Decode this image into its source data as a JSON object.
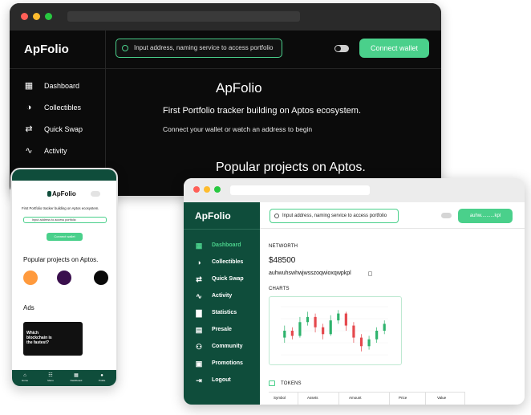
{
  "dark_window": {
    "logo": "ApFolio",
    "search_placeholder": "Input address, naming service to access portfolio",
    "connect_label": "Connect wallet",
    "nav": [
      {
        "label": "Dashboard",
        "icon": "grid-icon"
      },
      {
        "label": "Collectibles",
        "icon": "palette-icon"
      },
      {
        "label": "Quick Swap",
        "icon": "swap-icon"
      },
      {
        "label": "Activity",
        "icon": "activity-icon"
      }
    ],
    "hero_title": "ApFolio",
    "hero_subtitle": "First Portfolio tracker building on Aptos ecosystem.",
    "hero_desc": "Connect your wallet or watch an address to begin",
    "popular_title": "Popular projects on Aptos."
  },
  "phone": {
    "logo": "ApFolio",
    "tagline": "First Portfolio tracker building on Aptos ecosystem.",
    "search_placeholder": "Input address to access portfolio",
    "connect_label": "Connect wallet",
    "popular_title": "Popular projects on Aptos.",
    "ads_title": "Ads",
    "banner_lines": [
      "Which",
      "blockchain is",
      "the fastest?"
    ],
    "tabs": [
      {
        "label": "Home",
        "icon": "home-icon"
      },
      {
        "label": "Menu",
        "icon": "menu-icon"
      },
      {
        "label": "Dashboard",
        "icon": "dashboard-icon"
      },
      {
        "label": "Profile",
        "icon": "profile-icon"
      }
    ]
  },
  "light_window": {
    "logo": "ApFolio",
    "search_placeholder": "Input address, naming service to access portfolio",
    "address_button": "auhw..........kpl",
    "nav": [
      {
        "label": "Dashboard",
        "icon": "grid-icon",
        "active": true
      },
      {
        "label": "Collectibles",
        "icon": "palette-icon",
        "active": false
      },
      {
        "label": "Quick Swap",
        "icon": "swap-icon",
        "active": false
      },
      {
        "label": "Activity",
        "icon": "activity-icon",
        "active": false
      },
      {
        "label": "Statistics",
        "icon": "stats-icon",
        "active": false
      },
      {
        "label": "Presale",
        "icon": "presale-icon",
        "active": false
      },
      {
        "label": "Community",
        "icon": "community-icon",
        "active": false
      },
      {
        "label": "Promotions",
        "icon": "promotions-icon",
        "active": false
      },
      {
        "label": "Logout",
        "icon": "logout-icon",
        "active": false
      }
    ],
    "networth_label": "NETWORTH",
    "networth_value": "$48500",
    "wallet_address": "auhwuhswhwjwsszoqwioxqwpkpl",
    "charts_label": "CHARTS",
    "tokens_label": "TOKENS",
    "table_headers": [
      "Symbol",
      "Assets",
      "Amount",
      "Price",
      "Value"
    ]
  },
  "colors": {
    "accent": "#4ad08b",
    "sidebar": "#0f4d3b",
    "dark_bg": "#0b0b0b",
    "candle_up": "#2fb36d",
    "candle_down": "#e5484d"
  },
  "chart_data": {
    "type": "candlestick",
    "candles": [
      {
        "o": 48,
        "c": 52,
        "h": 55,
        "l": 45
      },
      {
        "o": 52,
        "c": 49,
        "h": 54,
        "l": 47
      },
      {
        "o": 49,
        "c": 57,
        "h": 60,
        "l": 48
      },
      {
        "o": 57,
        "c": 60,
        "h": 63,
        "l": 55
      },
      {
        "o": 60,
        "c": 54,
        "h": 62,
        "l": 51
      },
      {
        "o": 54,
        "c": 50,
        "h": 56,
        "l": 47
      },
      {
        "o": 50,
        "c": 58,
        "h": 61,
        "l": 49
      },
      {
        "o": 58,
        "c": 62,
        "h": 64,
        "l": 56
      },
      {
        "o": 62,
        "c": 55,
        "h": 63,
        "l": 52
      },
      {
        "o": 55,
        "c": 48,
        "h": 57,
        "l": 45
      },
      {
        "o": 48,
        "c": 43,
        "h": 50,
        "l": 40
      },
      {
        "o": 43,
        "c": 47,
        "h": 49,
        "l": 41
      },
      {
        "o": 47,
        "c": 52,
        "h": 54,
        "l": 45
      },
      {
        "o": 52,
        "c": 56,
        "h": 58,
        "l": 50
      }
    ],
    "ylim": [
      38,
      66
    ]
  }
}
